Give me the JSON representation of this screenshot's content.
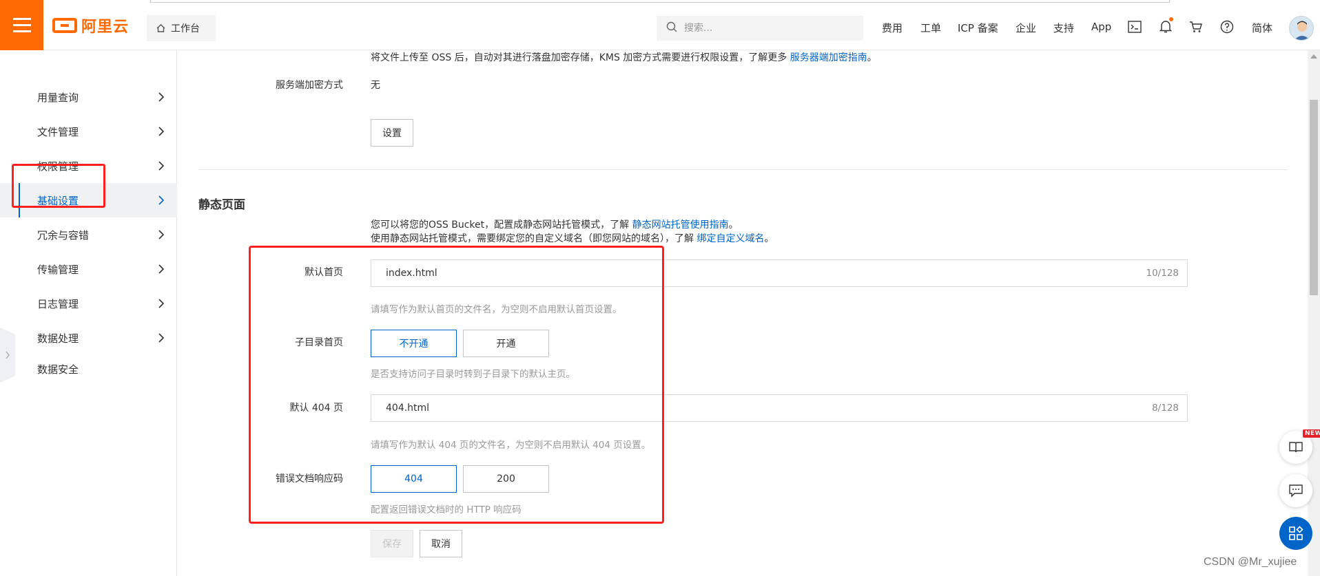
{
  "header": {
    "logo_text": "阿里云",
    "workbench_label": "工作台",
    "search_placeholder": "搜索...",
    "nav": [
      "费用",
      "工单",
      "ICP 备案",
      "企业",
      "支持",
      "App"
    ],
    "lang": "简体"
  },
  "sidebar": {
    "items": [
      {
        "label": "用量查询",
        "chevron": true
      },
      {
        "label": "文件管理",
        "chevron": true
      },
      {
        "label": "权限管理",
        "chevron": true
      },
      {
        "label": "基础设置",
        "chevron": true,
        "active": true
      },
      {
        "label": "冗余与容错",
        "chevron": true
      },
      {
        "label": "传输管理",
        "chevron": true
      },
      {
        "label": "日志管理",
        "chevron": true
      },
      {
        "label": "数据处理",
        "chevron": true
      },
      {
        "label": "数据安全",
        "chevron": false
      }
    ]
  },
  "encryption": {
    "desc_text": "将文件上传至 OSS 后，自动对其进行落盘加密存储，KMS 加密方式需要进行权限设置，了解更多 ",
    "desc_link": "服务器端加密指南",
    "desc_end": "。",
    "label": "服务端加密方式",
    "value": "无",
    "settings_button": "设置"
  },
  "static_page": {
    "title": "静态页面",
    "intro1_text": "您可以将您的OSS Bucket，配置成静态网站托管模式，了解 ",
    "intro1_link": "静态网站托管使用指南",
    "intro1_end": "。",
    "intro2_text": "使用静态网站托管模式，需要绑定您的自定义域名（即您网站的域名），了解 ",
    "intro2_link": "绑定自定义域名",
    "intro2_end": "。",
    "default_index": {
      "label": "默认首页",
      "value": "index.html",
      "count": "10/128",
      "hint": "请填写作为默认首页的文件名，为空则不启用默认首页设置。"
    },
    "subdir_index": {
      "label": "子目录首页",
      "options": [
        "不开通",
        "开通"
      ],
      "selected": "不开通",
      "hint": "是否支持访问子目录时转到子目录下的默认主页。"
    },
    "default_404": {
      "label": "默认 404 页",
      "value": "404.html",
      "count": "8/128",
      "hint": "请填写作为默认 404 页的文件名，为空则不启用默认 404 页设置。"
    },
    "error_code": {
      "label": "错误文档响应码",
      "options": [
        "404",
        "200"
      ],
      "selected": "404",
      "hint": "配置返回错误文档时的 HTTP 响应码"
    },
    "save_button": "保存",
    "cancel_button": "取消"
  },
  "floating": {
    "new_badge": "NEW"
  },
  "watermark": "CSDN @Mr_xujiee",
  "colors": {
    "brand": "#ff6a00",
    "primary": "#0064c8",
    "highlight_box": "#ff1f1f"
  }
}
